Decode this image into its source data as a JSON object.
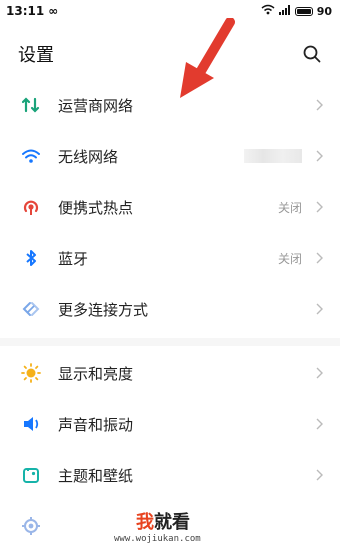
{
  "status_bar": {
    "time": "13:11",
    "battery": "90"
  },
  "header": {
    "title": "设置"
  },
  "settings": [
    {
      "label": "运营商网络",
      "value": ""
    },
    {
      "label": "无线网络",
      "value": ""
    },
    {
      "label": "便携式热点",
      "value": "关闭"
    },
    {
      "label": "蓝牙",
      "value": "关闭"
    },
    {
      "label": "更多连接方式",
      "value": ""
    },
    {
      "label": "显示和亮度",
      "value": ""
    },
    {
      "label": "声音和振动",
      "value": ""
    },
    {
      "label": "主题和壁纸",
      "value": ""
    }
  ],
  "watermark": {
    "part1": "我",
    "part2": "就看",
    "url": "www.wojiukan.com"
  },
  "colors": {
    "accent_green": "#1aa37a",
    "wifi_blue": "#1677ff",
    "hotspot_red": "#e5463a",
    "arrow_red": "#e23b2e"
  }
}
